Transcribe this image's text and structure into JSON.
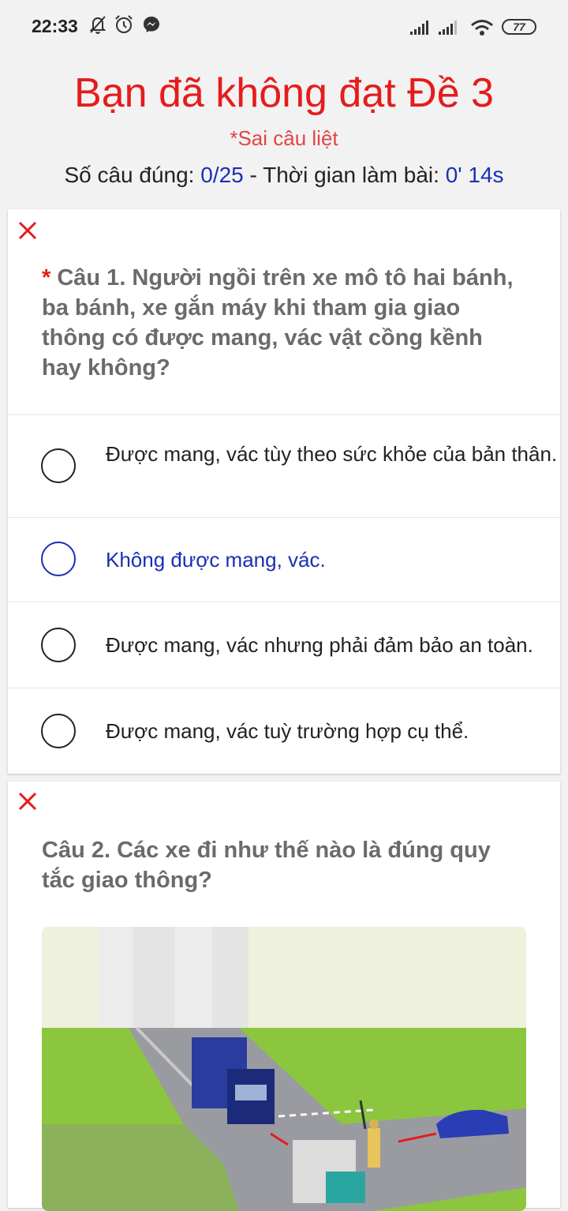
{
  "status_bar": {
    "time": "22:33",
    "battery": "77"
  },
  "result": {
    "title": "Bạn đã không đạt Đề 3",
    "note": "*Sai câu liệt",
    "score_label": "Số câu đúng: ",
    "score_value": "0/25",
    "time_label": " - Thời gian làm bài: ",
    "time_value": "0' 14s"
  },
  "questions": [
    {
      "required_mark": "* ",
      "text": "Câu 1.  Người ngồi trên xe mô tô hai bánh, ba bánh, xe gắn máy khi tham gia giao thông có được mang, vác vật cồng kềnh hay không?",
      "answers": [
        {
          "text": "Được mang, vác tùy theo sức khỏe của bản thân.",
          "selected": false
        },
        {
          "text": "Không được mang, vác.",
          "selected": true
        },
        {
          "text": "Được mang, vác nhưng phải đảm bảo an toàn.",
          "selected": false
        },
        {
          "text": "Được mang, vác tuỳ trường hợp cụ thể.",
          "selected": false
        }
      ]
    },
    {
      "text": "Câu 2.  Các xe đi như thế nào là đúng quy tắc giao thông?"
    }
  ],
  "colors": {
    "error": "#e51c1c",
    "accent": "#1a2fb5",
    "question": "#6b6b6b"
  }
}
